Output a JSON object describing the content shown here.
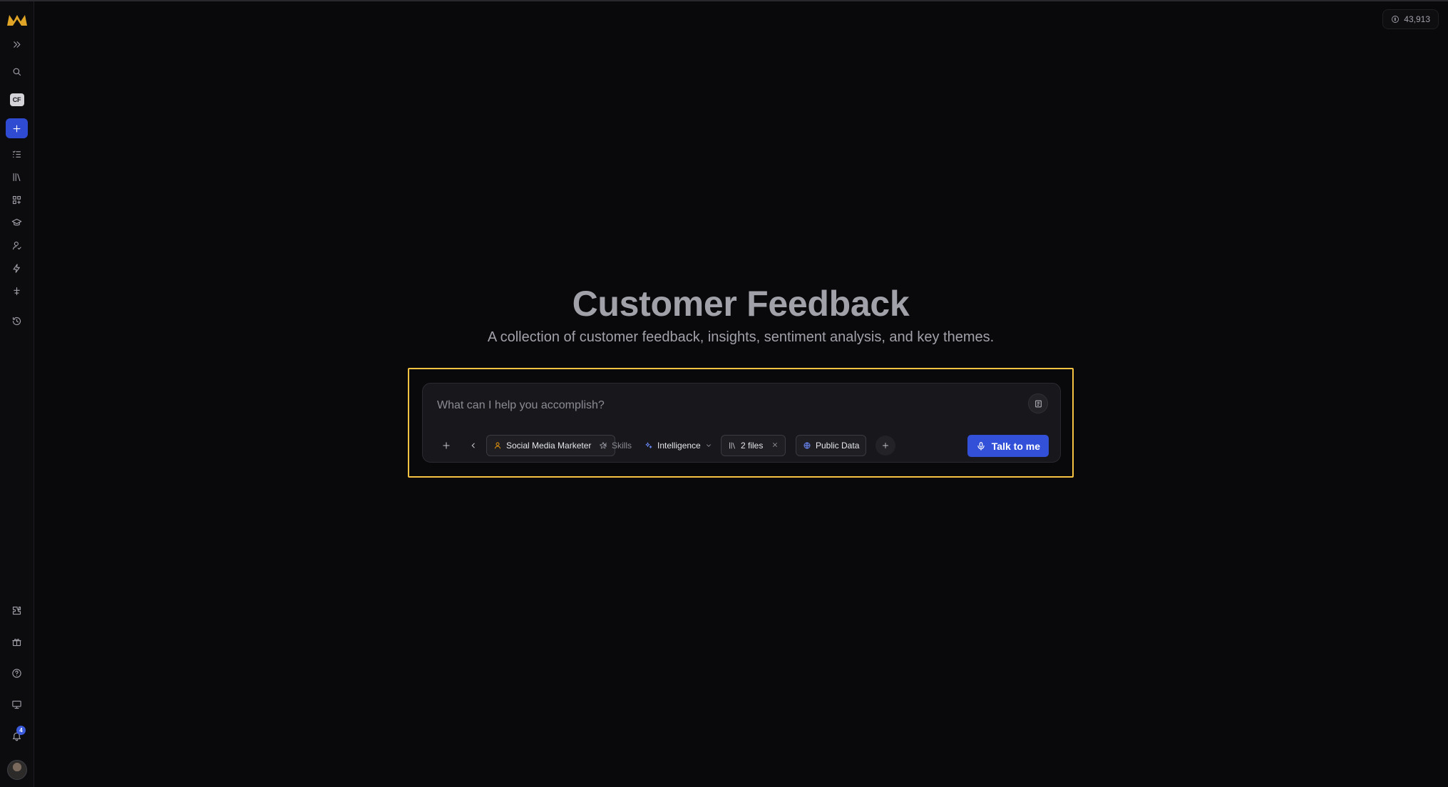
{
  "sidebar": {
    "workspace_badge": "CF",
    "notifications_count": "4",
    "items": [
      {
        "icon": "expand-icon"
      },
      {
        "icon": "search-icon"
      },
      {
        "icon": "workspace-icon"
      },
      {
        "icon": "plus-icon"
      },
      {
        "icon": "task-list-icon"
      },
      {
        "icon": "library-icon"
      },
      {
        "icon": "apps-icon"
      },
      {
        "icon": "graduation-cap-icon"
      },
      {
        "icon": "user-icon"
      },
      {
        "icon": "lightning-icon"
      },
      {
        "icon": "sparkle-icon"
      },
      {
        "icon": "history-icon"
      },
      {
        "icon": "puzzle-icon"
      },
      {
        "icon": "gift-icon"
      },
      {
        "icon": "help-icon"
      },
      {
        "icon": "monitor-icon"
      },
      {
        "icon": "bell-icon"
      }
    ]
  },
  "credits": {
    "value": "43,913"
  },
  "main": {
    "title": "Customer Feedback",
    "subtitle": "A collection of customer feedback, insights, sentiment analysis, and key themes."
  },
  "composer": {
    "placeholder": "What can I help you accomplish?",
    "chips": {
      "persona": "Social Media Marketer",
      "skills": "Skills",
      "intelligence": "Intelligence",
      "files": "2 files",
      "public_data": "Public Data"
    },
    "talk_button": "Talk to me"
  },
  "colors": {
    "background": "#09090b",
    "accent": "#3350d8",
    "highlight": "#f5c242",
    "logo": "#e0a526"
  }
}
